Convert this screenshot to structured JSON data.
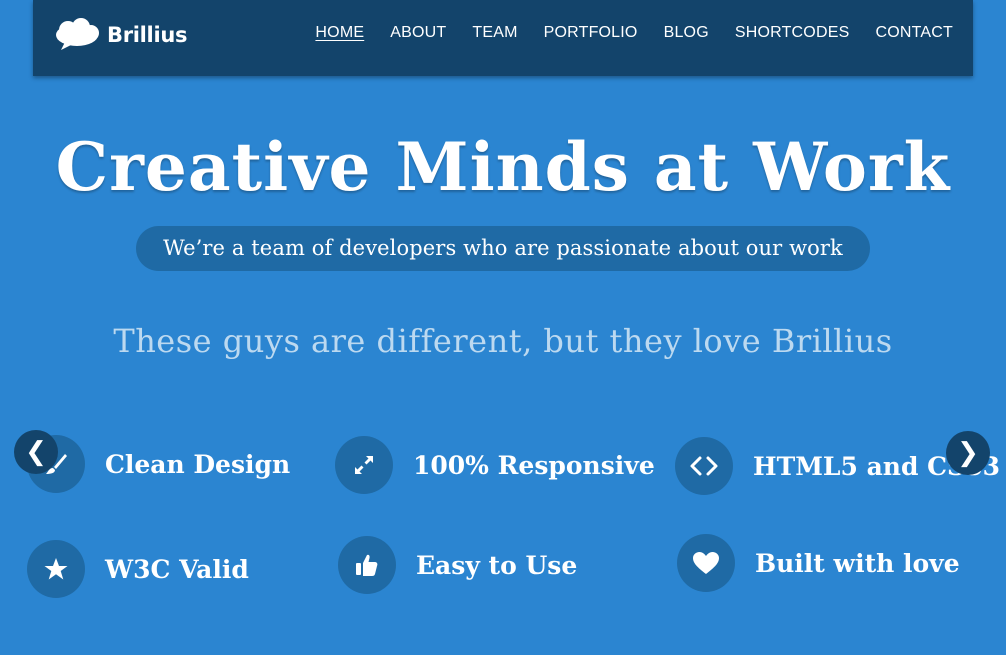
{
  "brand": {
    "name": "Brillius",
    "icon": "cloud-logo-icon"
  },
  "nav": {
    "items": [
      {
        "label": "HOME",
        "active": true
      },
      {
        "label": "ABOUT"
      },
      {
        "label": "TEAM"
      },
      {
        "label": "PORTFOLIO"
      },
      {
        "label": "BLOG"
      },
      {
        "label": "SHORTCODES"
      },
      {
        "label": "CONTACT"
      }
    ]
  },
  "hero": {
    "title": "Creative Minds at Work",
    "tagline": "We’re a team of developers who are passionate about our work"
  },
  "section": {
    "subheading": "These guys are different, but they love Brillius"
  },
  "carousel": {
    "prev_label": "❮",
    "next_label": "❯"
  },
  "features": [
    {
      "label": "Clean Design",
      "icon": "brush-icon"
    },
    {
      "label": "100% Responsive",
      "icon": "expand-icon"
    },
    {
      "label": "HTML5 and CSS3",
      "icon": "code-icon"
    },
    {
      "label": "W3C Valid",
      "icon": "star-icon"
    },
    {
      "label": "Easy to Use",
      "icon": "thumbs-up-icon"
    },
    {
      "label": "Built with love",
      "icon": "heart-icon"
    }
  ],
  "colors": {
    "background": "#2b85d1",
    "navbar": "#13446b",
    "pill": "#1f6aa5",
    "subhead_text": "#bcd9f0",
    "text": "#ffffff"
  }
}
